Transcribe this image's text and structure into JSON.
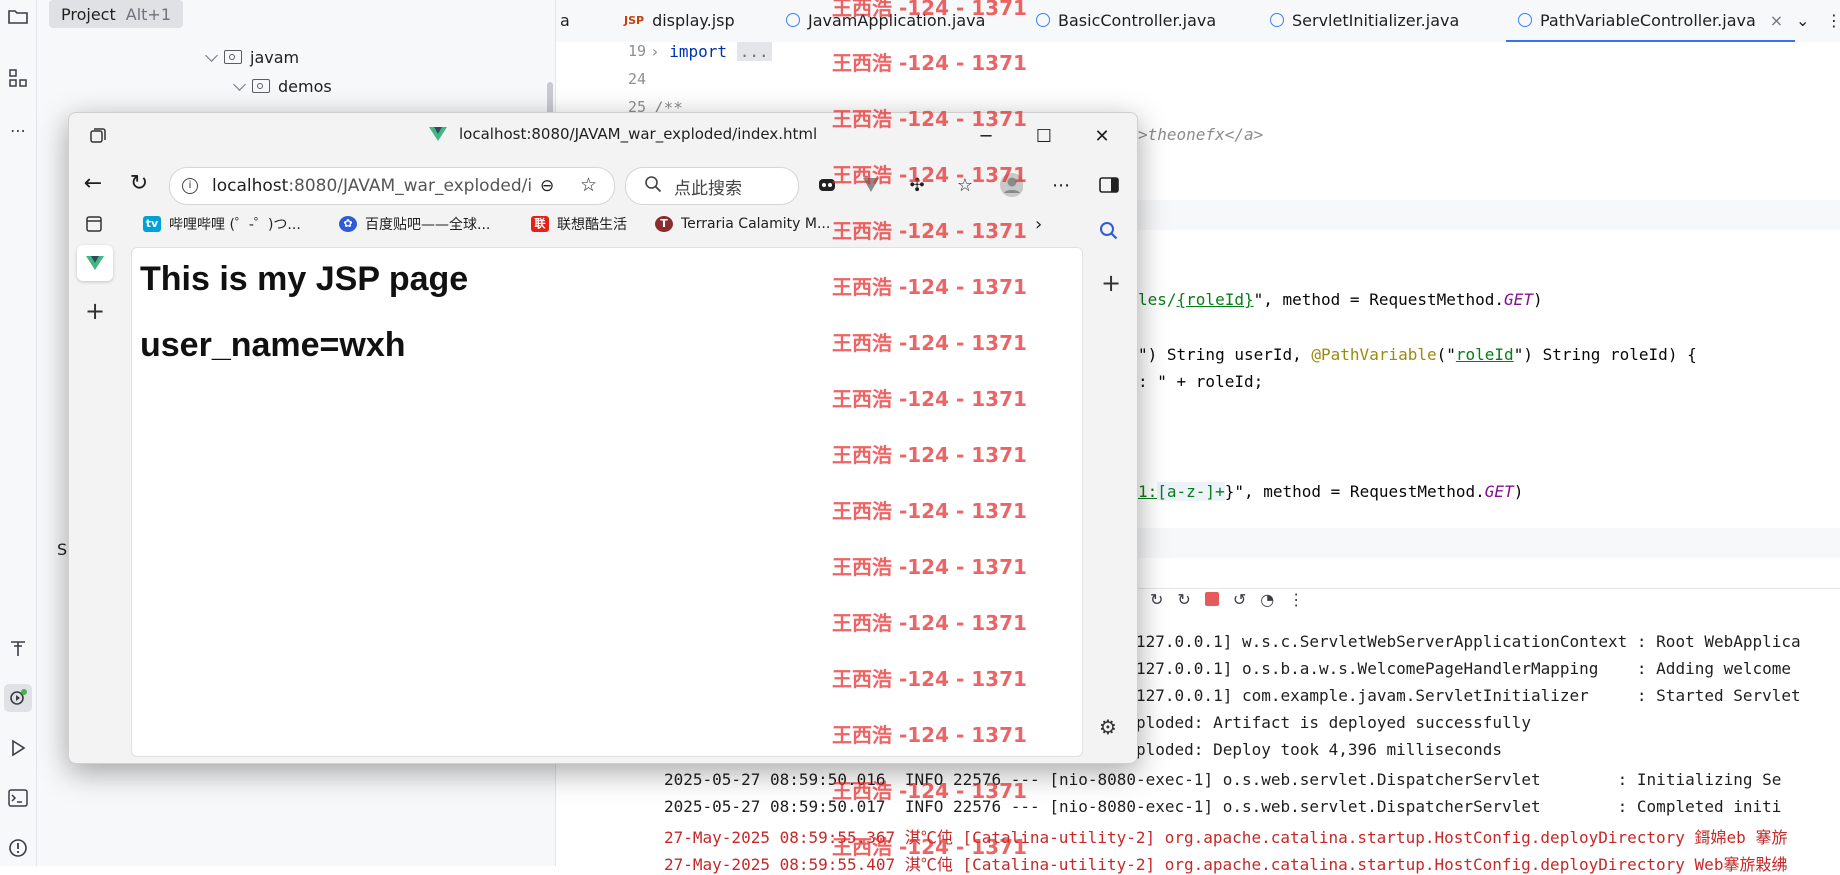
{
  "ide": {
    "project_tab": {
      "label": "Project",
      "shortcut": "Alt+1"
    },
    "tree": [
      {
        "label": "javam"
      },
      {
        "label": "demos"
      }
    ],
    "services_label": "S",
    "tabs": [
      {
        "label": "a"
      },
      {
        "label": "display.jsp",
        "icon": "JSP"
      },
      {
        "label": "JavamApplication.java"
      },
      {
        "label": "BasicController.java"
      },
      {
        "label": "ServletInitializer.java"
      },
      {
        "label": "PathVariableController.java",
        "close": "×"
      }
    ],
    "line_numbers": [
      "19",
      "24",
      "25"
    ],
    "code": {
      "import_kw": "import",
      "import_rest": "...",
      "doc_start": "/**",
      "link_text": ">theonefx</a>",
      "mapping1_a": "les/",
      "mapping1_b": "{roleId}",
      "mapping1_c": "\", method = RequestMethod.",
      "get1": "GET",
      "mapping1_d": ")",
      "sig_a": "\") String userId, ",
      "sig_ann": "@PathVariable",
      "sig_b": "(\"",
      "sig_c": "roleId",
      "sig_d": "\") String roleId) {",
      "ret_line": ": \" + roleId;",
      "mapping2_a": "1:",
      "mapping2_b": "[a-z-]+",
      "mapping2_c": "}\", method = RequestMethod.",
      "get2": "GET",
      "mapping2_d": ")"
    },
    "console_lines": [
      {
        "text": "127.0.0.1] w.s.c.ServletWebServerApplicationContext : Root WebApplica",
        "err": false
      },
      {
        "text": "127.0.0.1] o.s.b.a.w.s.WelcomePageHandlerMapping    : Adding welcome",
        "err": false
      },
      {
        "text": "127.0.0.1] com.example.javam.ServletInitializer     : Started Servlet",
        "err": false
      },
      {
        "text": "ploded: Artifact is deployed successfully",
        "err": false
      },
      {
        "text": "ploded: Deploy took 4,396 milliseconds",
        "err": false
      },
      {
        "text": "2025-05-27 08:59:50.016  INFO 22576 --- [nio-8080-exec-1] o.s.web.servlet.DispatcherServlet        : Initializing Se",
        "err": false
      },
      {
        "text": "2025-05-27 08:59:50.017  INFO 22576 --- [nio-8080-exec-1] o.s.web.servlet.DispatcherServlet        : Completed initi",
        "err": false
      },
      {
        "text": "27-May-2025 08:59:55.367 淇℃伅 [Catalina-utility-2] org.apache.catalina.startup.HostConfig.deployDirectory 鎶婂eb 搴旂",
        "err": true
      },
      {
        "text": "27-May-2025 08:59:55.407 淇℃伅 [Catalina-utility-2] org.apache.catalina.startup.HostConfig.deployDirectory Web搴旂敤绋",
        "err": true
      }
    ]
  },
  "browser": {
    "window_title": "localhost:8080/JAVAM_war_exploded/index.html",
    "address_host": "localhost",
    "address_rest": ":8080/JAVAM_war_exploded/i...",
    "search_placeholder": "点此搜索",
    "favorites": [
      {
        "label": "哔哩哔哩 (゜-゜)つ..."
      },
      {
        "label": "百度贴吧——全球..."
      },
      {
        "label": "联想酷生活"
      },
      {
        "label": "Terraria Calamity M..."
      }
    ],
    "page_heading": "This is my JSP page",
    "page_user": "user_name=wxh"
  },
  "watermark": {
    "text": "王西浩 -124 - 1371"
  },
  "colors": {
    "accent": "#3574f0",
    "watermark": "#e62828",
    "vue_green": "#41b883",
    "stop": "#e55b5b"
  }
}
